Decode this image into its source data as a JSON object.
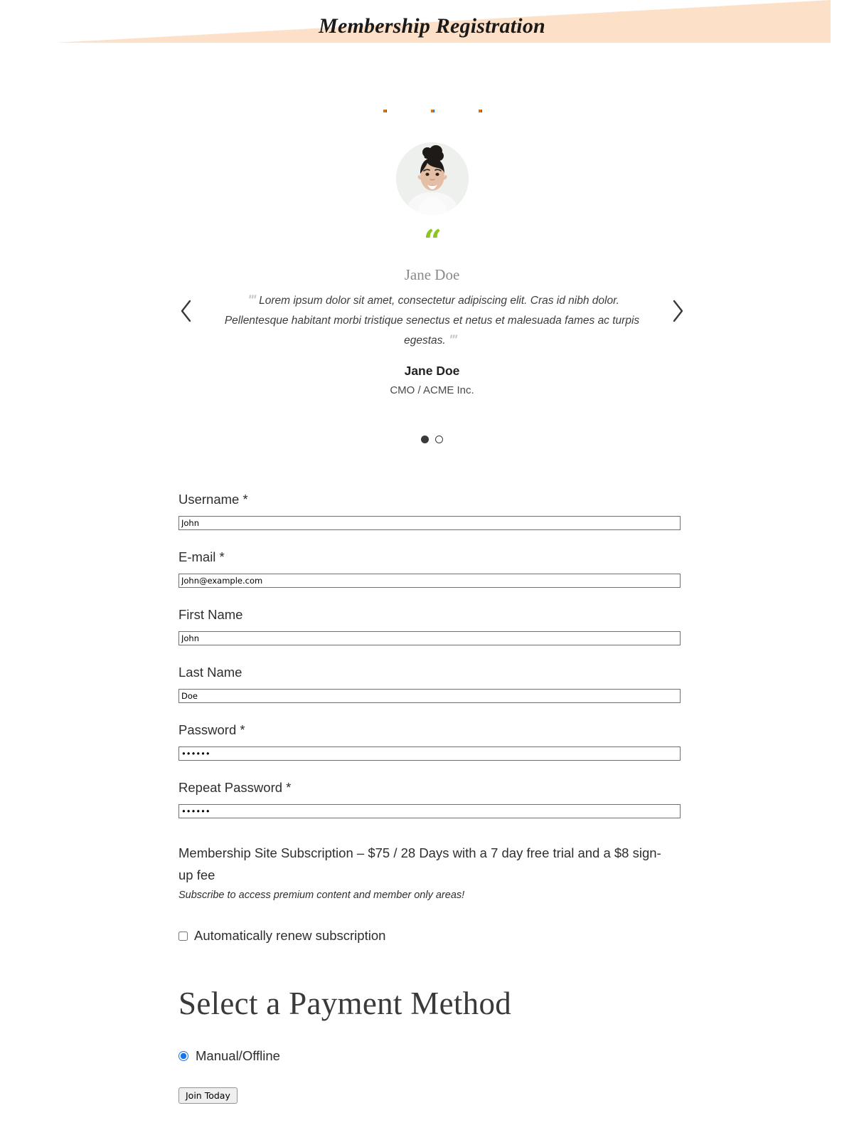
{
  "header": {
    "title": "Membership Registration",
    "banner_color": "#fde0c8"
  },
  "testimonial": {
    "rating_markers": [
      "rating-dot",
      "rating-dot",
      "rating-dot"
    ],
    "avatar_alt": "Jane Doe portrait",
    "quote_icon": "“",
    "quote_icon_color": "#8cc520",
    "name_top": "Jane Doe",
    "open_quote_mark": "‴",
    "close_quote_mark": "‴",
    "quote": "Lorem ipsum dolor sit amet, consectetur adipiscing elit. Cras id nibh dolor. Pellentesque habitant morbi tristique senectus et netus et malesuada fames ac turpis egestas.",
    "author_name": "Jane Doe",
    "author_role": "CMO / ACME Inc.",
    "prev_label": "Previous testimonial",
    "next_label": "Next testimonial",
    "pager": [
      {
        "state": "active"
      },
      {
        "state": "inactive"
      }
    ]
  },
  "form": {
    "fields": [
      {
        "label": "Username *",
        "value": "John",
        "placeholder": "",
        "type": "text",
        "name": "username"
      },
      {
        "label": "E-mail *",
        "value": "John@example.com",
        "placeholder": "",
        "type": "text",
        "name": "email"
      },
      {
        "label": "First Name",
        "value": "John",
        "placeholder": "",
        "type": "text",
        "name": "first-name"
      },
      {
        "label": "Last Name",
        "value": "Doe",
        "placeholder": "",
        "type": "text",
        "name": "last-name"
      },
      {
        "label": "Password *",
        "value": "secret",
        "placeholder": "",
        "type": "password",
        "name": "password"
      },
      {
        "label": "Repeat Password *",
        "value": "secret",
        "placeholder": "",
        "type": "password",
        "name": "repeat-password"
      }
    ],
    "subscription_title": "Membership Site Subscription – $75 / 28 Days with a 7 day free trial and a $8 sign-up fee",
    "subscription_description": "Subscribe to access premium content and member only areas!",
    "auto_renew_label": "Automatically renew subscription",
    "auto_renew_checked": false
  },
  "payment": {
    "heading": "Select a Payment Method",
    "options": [
      {
        "label": "Manual/Offline",
        "selected": true
      }
    ],
    "submit_label": "Join Today",
    "accent_color": "#1a73e8"
  }
}
